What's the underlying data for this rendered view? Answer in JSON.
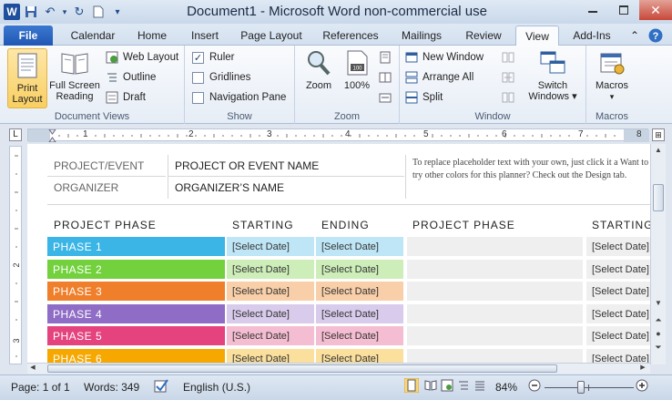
{
  "titlebar": {
    "title": "Document1  -  Microsoft Word non-commercial use",
    "logo_letter": "W",
    "colors": {
      "accent": "#2157b3"
    }
  },
  "tabs": [
    {
      "label": "File"
    },
    {
      "label": "Calendar"
    },
    {
      "label": "Home"
    },
    {
      "label": "Insert"
    },
    {
      "label": "Page Layout"
    },
    {
      "label": "References"
    },
    {
      "label": "Mailings"
    },
    {
      "label": "Review"
    },
    {
      "label": "View"
    },
    {
      "label": "Add-Ins"
    }
  ],
  "ribbon": {
    "document_views": {
      "label": "Document Views",
      "print_layout": "Print\nLayout",
      "full_screen": "Full Screen\nReading",
      "web_layout": "Web Layout",
      "outline": "Outline",
      "draft": "Draft"
    },
    "show": {
      "label": "Show",
      "ruler": "Ruler",
      "gridlines": "Gridlines",
      "navigation_pane": "Navigation Pane",
      "ruler_checked": true
    },
    "zoom": {
      "label": "Zoom",
      "zoom_btn": "Zoom",
      "hundred": "100%"
    },
    "window": {
      "label": "Window",
      "new_window": "New Window",
      "arrange_all": "Arrange All",
      "split": "Split",
      "switch_windows": "Switch\nWindows ▾"
    },
    "macros": {
      "label": "Macros",
      "macros_btn": "Macros"
    }
  },
  "ruler": {
    "numbers": [
      "1",
      "2",
      "3",
      "4",
      "5",
      "6",
      "7",
      "8"
    ]
  },
  "document": {
    "project_event_label": "PROJECT/EVENT",
    "project_event_value": "PROJECT OR EVENT NAME",
    "organizer_label": "ORGANIZER",
    "organizer_value": "ORGANIZER’S NAME",
    "tip_text": "To replace placeholder text with your own, just click it a Want to try other colors for this planner? Check out the Design tab.",
    "headers": {
      "phase": "PROJECT  PHASE",
      "starting": "STARTING",
      "ending": "ENDING",
      "phase2": "PROJECT  PHASE",
      "starting2": "STARTING"
    },
    "rows": [
      {
        "phase": "PHASE 1",
        "start": "[Select Date]",
        "end": "[Select Date]",
        "start2": "[Select Date]",
        "color": "#3ab5e6",
        "light": "#bfe6f6"
      },
      {
        "phase": "PHASE 2",
        "start": "[Select Date]",
        "end": "[Select Date]",
        "start2": "[Select Date]",
        "color": "#72d13d",
        "light": "#cdeeb9"
      },
      {
        "phase": "PHASE 3",
        "start": "[Select Date]",
        "end": "[Select Date]",
        "start2": "[Select Date]",
        "color": "#f07f2b",
        "light": "#f9cfa9"
      },
      {
        "phase": "PHASE 4",
        "start": "[Select Date]",
        "end": "[Select Date]",
        "start2": "[Select Date]",
        "color": "#8f6dc6",
        "light": "#d8cbeb"
      },
      {
        "phase": "PHASE 5",
        "start": "[Select Date]",
        "end": "[Select Date]",
        "start2": "[Select Date]",
        "color": "#e4437d",
        "light": "#f4bdd1"
      },
      {
        "phase": "PHASE 6",
        "start": "[Select Date]",
        "end": "[Select Date]",
        "start2": "[Select Date]",
        "color": "#f6a800",
        "light": "#fbdf9c"
      }
    ]
  },
  "statusbar": {
    "page": "Page: 1 of 1",
    "words": "Words: 349",
    "language": "English (U.S.)",
    "zoom": "84%"
  }
}
